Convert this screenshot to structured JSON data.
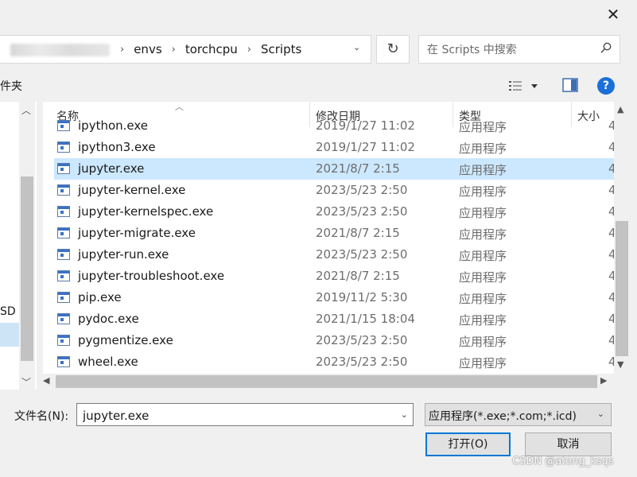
{
  "window": {
    "close_glyph": "✕"
  },
  "address_bar": {
    "breadcrumbs": [
      "envs",
      "torchcpu",
      "Scripts"
    ],
    "separator": "›",
    "dropdown_glyph": "⌄",
    "refresh_glyph": "↻"
  },
  "search": {
    "placeholder": "在 Scripts 中搜索",
    "icon": "search-icon"
  },
  "toolbar": {
    "new_folder_label": "件夹",
    "view_menu_icon": "view-details-icon",
    "preview_icon": "preview-pane-icon",
    "help_label": "?"
  },
  "left_pane": {
    "drive_label": "SD ("
  },
  "columns": {
    "name": "名称",
    "date": "修改日期",
    "type": "类型",
    "size": "大小"
  },
  "files": [
    {
      "name": "ipython.exe",
      "date": "2019/1/27 11:02",
      "type": "应用程序",
      "trunc": "4",
      "selected": false
    },
    {
      "name": "ipython3.exe",
      "date": "2019/1/27 11:02",
      "type": "应用程序",
      "trunc": "4",
      "selected": false
    },
    {
      "name": "jupyter.exe",
      "date": "2021/8/7 2:15",
      "type": "应用程序",
      "trunc": "4",
      "selected": true
    },
    {
      "name": "jupyter-kernel.exe",
      "date": "2023/5/23 2:50",
      "type": "应用程序",
      "trunc": "4",
      "selected": false
    },
    {
      "name": "jupyter-kernelspec.exe",
      "date": "2023/5/23 2:50",
      "type": "应用程序",
      "trunc": "4",
      "selected": false
    },
    {
      "name": "jupyter-migrate.exe",
      "date": "2021/8/7 2:15",
      "type": "应用程序",
      "trunc": "4",
      "selected": false
    },
    {
      "name": "jupyter-run.exe",
      "date": "2023/5/23 2:50",
      "type": "应用程序",
      "trunc": "4",
      "selected": false
    },
    {
      "name": "jupyter-troubleshoot.exe",
      "date": "2021/8/7 2:15",
      "type": "应用程序",
      "trunc": "4",
      "selected": false
    },
    {
      "name": "pip.exe",
      "date": "2019/11/2 5:30",
      "type": "应用程序",
      "trunc": "4",
      "selected": false
    },
    {
      "name": "pydoc.exe",
      "date": "2021/1/15 18:04",
      "type": "应用程序",
      "trunc": "4",
      "selected": false
    },
    {
      "name": "pygmentize.exe",
      "date": "2023/5/23 2:50",
      "type": "应用程序",
      "trunc": "4",
      "selected": false
    },
    {
      "name": "wheel.exe",
      "date": "2023/5/23 2:50",
      "type": "应用程序",
      "trunc": "4",
      "selected": false
    }
  ],
  "bottom": {
    "filename_label": "文件名(N):",
    "filename_value": "jupyter.exe",
    "filter_label": "应用程序(*.exe;*.com;*.icd)",
    "open_label": "打开(O)",
    "cancel_label": "取消"
  },
  "watermark": "CSDN @atong_ksqs",
  "colors": {
    "selection": "#cce8ff",
    "accent": "#0078d7",
    "help": "#1a6fd8"
  }
}
